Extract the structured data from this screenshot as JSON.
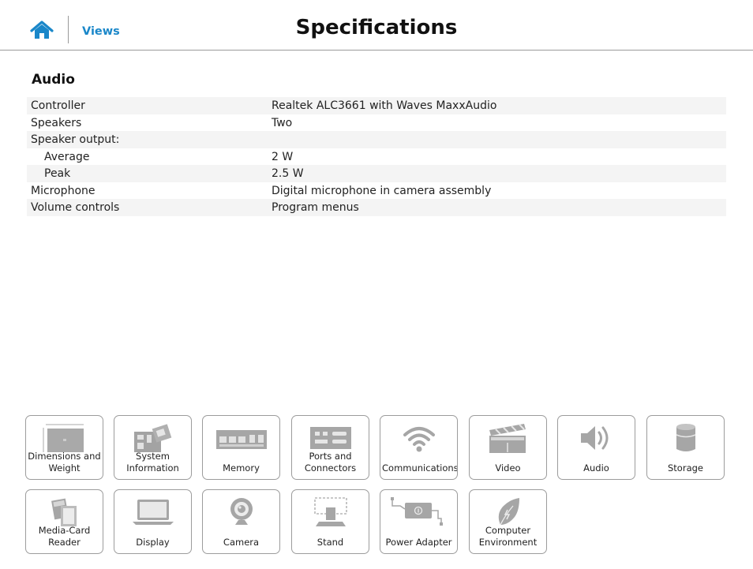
{
  "header": {
    "title": "Specifications",
    "home_icon": "home-icon",
    "views_label": "Views",
    "accent_color": "#1a87c9"
  },
  "section": {
    "title": "Audio",
    "rows": [
      {
        "label": "Controller",
        "value": "Realtek ALC3661 with Waves MaxxAudio"
      },
      {
        "label": "Speakers",
        "value": "Two"
      },
      {
        "label": "Speaker output:",
        "value": ""
      },
      {
        "label": "Average",
        "value": "2 W"
      },
      {
        "label": "Peak",
        "value": "2.5 W"
      },
      {
        "label": "Microphone",
        "value": "Digital microphone in camera assembly"
      },
      {
        "label": "Volume controls",
        "value": "Program menus"
      }
    ]
  },
  "tiles": [
    {
      "label": "Dimensions and\nWeight",
      "icon": "dimensions-icon"
    },
    {
      "label": "System\nInformation",
      "icon": "system-board-icon"
    },
    {
      "label": "Memory",
      "icon": "memory-module-icon"
    },
    {
      "label": "Ports and\nConnectors",
      "icon": "ports-icon"
    },
    {
      "label": "Communications",
      "icon": "wifi-icon"
    },
    {
      "label": "Video",
      "icon": "clapperboard-icon"
    },
    {
      "label": "Audio",
      "icon": "speaker-icon"
    },
    {
      "label": "Storage",
      "icon": "storage-cylinder-icon"
    },
    {
      "label": "Media-Card\nReader",
      "icon": "media-card-icon"
    },
    {
      "label": "Display",
      "icon": "laptop-display-icon"
    },
    {
      "label": "Camera",
      "icon": "webcam-icon"
    },
    {
      "label": "Stand",
      "icon": "stand-icon"
    },
    {
      "label": "Power Adapter",
      "icon": "power-adapter-icon"
    },
    {
      "label": "Computer\nEnvironment",
      "icon": "leaf-icon"
    }
  ]
}
